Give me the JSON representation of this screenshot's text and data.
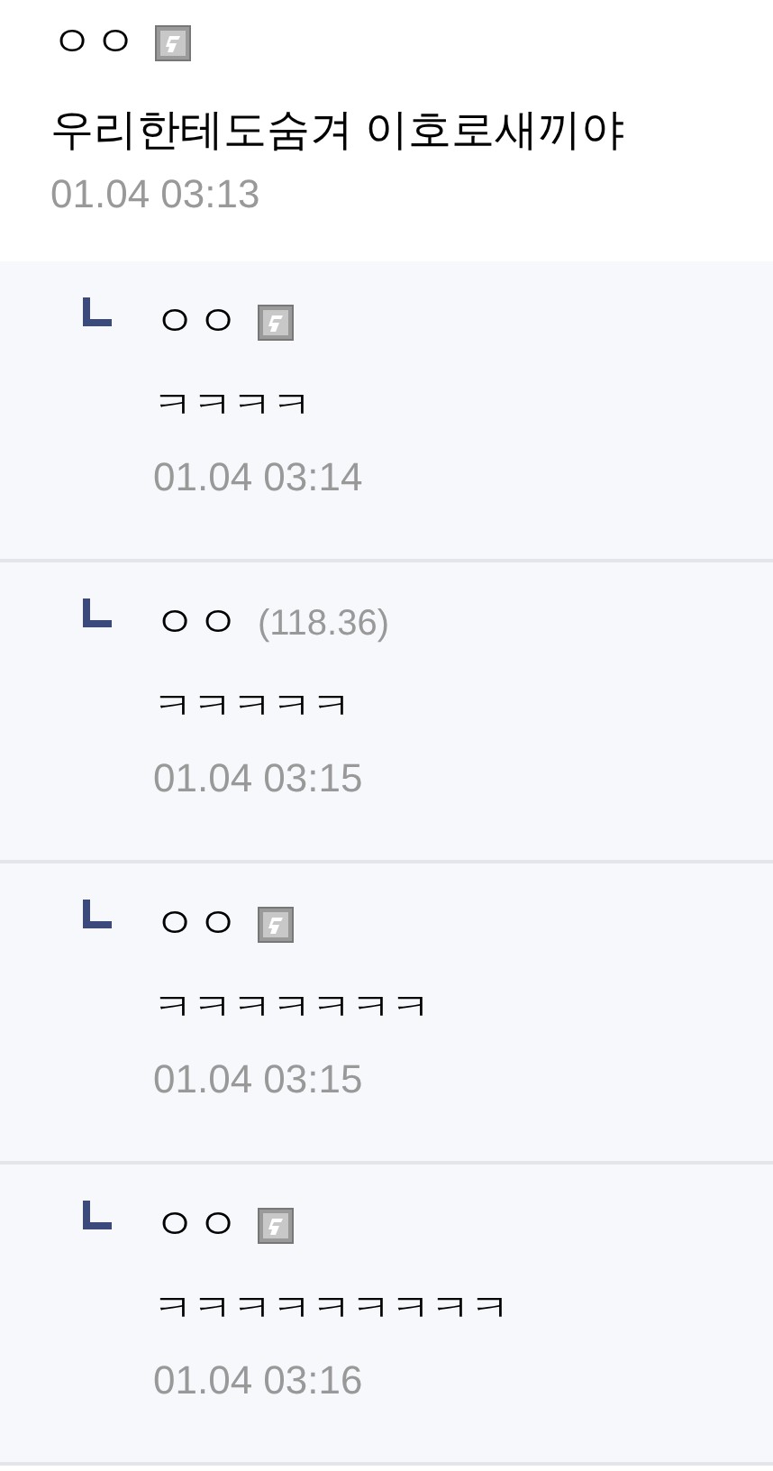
{
  "comment": {
    "author": {
      "name": "ㅇㅇ",
      "kind": "badge"
    },
    "text": "우리한테도숨겨 이호로새끼야",
    "time": "01.04 03:13"
  },
  "replies": [
    {
      "author": {
        "name": "ㅇㅇ",
        "kind": "badge"
      },
      "text": "ㅋㅋㅋㅋ",
      "time": "01.04 03:14"
    },
    {
      "author": {
        "name": "ㅇㅇ",
        "kind": "ip",
        "ip": "(118.36)"
      },
      "text": "ㅋㅋㅋㅋㅋ",
      "time": "01.04 03:15"
    },
    {
      "author": {
        "name": "ㅇㅇ",
        "kind": "badge"
      },
      "text": "ㅋㅋㅋㅋㅋㅋㅋ",
      "time": "01.04 03:15"
    },
    {
      "author": {
        "name": "ㅇㅇ",
        "kind": "badge"
      },
      "text": "ㅋㅋㅋㅋㅋㅋㅋㅋㅋ",
      "time": "01.04 03:16"
    }
  ]
}
